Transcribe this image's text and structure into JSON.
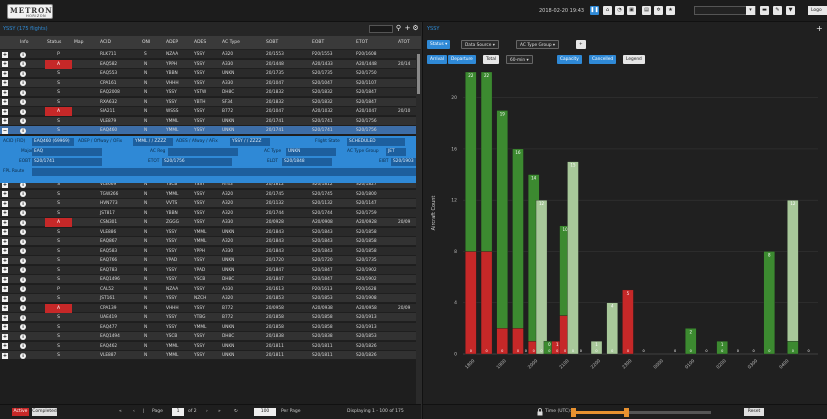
{
  "app": {
    "logo_main": "METRON",
    "logo_sub": "HORIZON",
    "clock": "2018-02-20 19:43"
  },
  "topbar": {
    "search_value": "",
    "logout_label": "Logo"
  },
  "left_panel": {
    "title": "YSSY (175 flights)",
    "columns": [
      "Info",
      "Status",
      "Map",
      "ACID",
      "ONI",
      "ADEP",
      "ADES",
      "AC Type",
      "SOBT",
      "EOBT",
      "ETOT",
      "ATOT"
    ],
    "rows": [
      {
        "status": "P",
        "red": false,
        "acid": "RLK711",
        "oni": "S",
        "adep": "NZAA",
        "ades": "YSSY",
        "actype": "A320",
        "sobt": "20/1553",
        "eobt": "P20/1553",
        "etot": "P20/1608",
        "atot": ""
      },
      {
        "status": "A",
        "red": true,
        "acid": "EAQ582",
        "oni": "N",
        "adep": "YPPH",
        "ades": "YSSY",
        "actype": "A330",
        "sobt": "20/1448",
        "eobt": "A20/1433",
        "etot": "A20/1448",
        "atot": "20/14"
      },
      {
        "status": "S",
        "red": false,
        "acid": "EAQ553",
        "oni": "N",
        "adep": "YBBN",
        "ades": "YSSY",
        "actype": "UNKN",
        "sobt": "20/1735",
        "eobt": "S20/1735",
        "etot": "S20/1750",
        "atot": ""
      },
      {
        "status": "S",
        "red": false,
        "acid": "CPA161",
        "oni": "N",
        "adep": "VHHH",
        "ades": "YSSY",
        "actype": "A330",
        "sobt": "20/1047",
        "eobt": "S20/1047",
        "etot": "S20/1107",
        "atot": ""
      },
      {
        "status": "S",
        "red": false,
        "acid": "EAQ2008",
        "oni": "N",
        "adep": "YSSY",
        "ades": "YSTW",
        "actype": "DH8C",
        "sobt": "20/1832",
        "eobt": "S20/1832",
        "etot": "S20/1847",
        "atot": ""
      },
      {
        "status": "S",
        "red": false,
        "acid": "RXA632",
        "oni": "N",
        "adep": "YSSY",
        "ades": "YBTH",
        "actype": "SF34",
        "sobt": "20/1832",
        "eobt": "S20/1832",
        "etot": "S20/1847",
        "atot": ""
      },
      {
        "status": "A",
        "red": true,
        "acid": "SIA211",
        "oni": "N",
        "adep": "WSSS",
        "ades": "YSSY",
        "actype": "B772",
        "sobt": "20/1047",
        "eobt": "A20/1032",
        "etot": "A20/1047",
        "atot": "20/10"
      },
      {
        "status": "S",
        "red": false,
        "acid": "VLE879",
        "oni": "N",
        "adep": "YMML",
        "ades": "YSSY",
        "actype": "UNKN",
        "sobt": "20/1741",
        "eobt": "S20/1741",
        "etot": "S20/1756",
        "atot": ""
      },
      {
        "status": "S",
        "red": false,
        "acid": "EAQ460",
        "oni": "N",
        "adep": "YMML",
        "ades": "YSSY",
        "actype": "UNKN",
        "sobt": "20/1741",
        "eobt": "S20/1741",
        "etot": "S20/1756",
        "atot": ""
      },
      {
        "status": "S",
        "red": false,
        "acid": "VLE669",
        "oni": "N",
        "adep": "YSCB",
        "ades": "YSSY",
        "actype": "AT43",
        "sobt": "20/1812",
        "eobt": "S20/1812",
        "etot": "S20/1827",
        "atot": ""
      },
      {
        "status": "S",
        "red": false,
        "acid": "TGW266",
        "oni": "N",
        "adep": "YMML",
        "ades": "YSSY",
        "actype": "A320",
        "sobt": "20/1745",
        "eobt": "S20/1745",
        "etot": "S20/1800",
        "atot": ""
      },
      {
        "status": "S",
        "red": false,
        "acid": "HVN773",
        "oni": "N",
        "adep": "VVTS",
        "ades": "YSSY",
        "actype": "A320",
        "sobt": "20/1132",
        "eobt": "S20/1132",
        "etot": "S20/1147",
        "atot": ""
      },
      {
        "status": "S",
        "red": false,
        "acid": "JST817",
        "oni": "N",
        "adep": "YBBN",
        "ades": "YSSY",
        "actype": "A320",
        "sobt": "20/1744",
        "eobt": "S20/1744",
        "etot": "S20/1759",
        "atot": ""
      },
      {
        "status": "A",
        "red": true,
        "acid": "CSN301",
        "oni": "N",
        "adep": "ZGGG",
        "ades": "YSSY",
        "actype": "A330",
        "sobt": "20/0928",
        "eobt": "A20/0908",
        "etot": "A20/0928",
        "atot": "20/09"
      },
      {
        "status": "S",
        "red": false,
        "acid": "VLE886",
        "oni": "N",
        "adep": "YSSY",
        "ades": "YMML",
        "actype": "UNKN",
        "sobt": "20/1843",
        "eobt": "S20/1843",
        "etot": "S20/1858",
        "atot": ""
      },
      {
        "status": "S",
        "red": false,
        "acid": "EAQ867",
        "oni": "N",
        "adep": "YSSY",
        "ades": "YMML",
        "actype": "A320",
        "sobt": "20/1843",
        "eobt": "S20/1843",
        "etot": "S20/1858",
        "atot": ""
      },
      {
        "status": "S",
        "red": false,
        "acid": "EAQ583",
        "oni": "N",
        "adep": "YSSY",
        "ades": "YPPH",
        "actype": "A330",
        "sobt": "20/1843",
        "eobt": "S20/1843",
        "etot": "S20/1858",
        "atot": ""
      },
      {
        "status": "S",
        "red": false,
        "acid": "EAQ766",
        "oni": "N",
        "adep": "YPAD",
        "ades": "YSSY",
        "actype": "UNKN",
        "sobt": "20/1720",
        "eobt": "S20/1720",
        "etot": "S20/1735",
        "atot": ""
      },
      {
        "status": "S",
        "red": false,
        "acid": "EAQ783",
        "oni": "N",
        "adep": "YSSY",
        "ades": "YPAD",
        "actype": "UNKN",
        "sobt": "20/1847",
        "eobt": "S20/1847",
        "etot": "S20/1902",
        "atot": ""
      },
      {
        "status": "S",
        "red": false,
        "acid": "EAQ1496",
        "oni": "N",
        "adep": "YSSY",
        "ades": "YSCB",
        "actype": "DH8C",
        "sobt": "20/1847",
        "eobt": "S20/1847",
        "etot": "S20/1902",
        "atot": ""
      },
      {
        "status": "P",
        "red": false,
        "acid": "CAL52",
        "oni": "N",
        "adep": "NZAA",
        "ades": "YSSY",
        "actype": "A330",
        "sobt": "20/1613",
        "eobt": "P20/1613",
        "etot": "P20/1628",
        "atot": ""
      },
      {
        "status": "S",
        "red": false,
        "acid": "JST161",
        "oni": "N",
        "adep": "YSSY",
        "ades": "NZCH",
        "actype": "A320",
        "sobt": "20/1853",
        "eobt": "S20/1853",
        "etot": "S20/1908",
        "atot": ""
      },
      {
        "status": "A",
        "red": true,
        "acid": "CPA139",
        "oni": "N",
        "adep": "VHHH",
        "ades": "YSSY",
        "actype": "B772",
        "sobt": "20/0958",
        "eobt": "A20/0938",
        "etot": "A20/0958",
        "atot": "20/09"
      },
      {
        "status": "S",
        "red": false,
        "acid": "UAE419",
        "oni": "N",
        "adep": "YSSY",
        "ades": "YTBG",
        "actype": "B772",
        "sobt": "20/1858",
        "eobt": "S20/1858",
        "etot": "S20/1913",
        "atot": ""
      },
      {
        "status": "S",
        "red": false,
        "acid": "EAQ477",
        "oni": "N",
        "adep": "YSSY",
        "ades": "YMML",
        "actype": "UNKN",
        "sobt": "20/1858",
        "eobt": "S20/1858",
        "etot": "S20/1913",
        "atot": ""
      },
      {
        "status": "S",
        "red": false,
        "acid": "EAQ1494",
        "oni": "N",
        "adep": "YSCB",
        "ades": "YSSY",
        "actype": "DH8C",
        "sobt": "20/1838",
        "eobt": "S20/1838",
        "etot": "S20/1853",
        "atot": ""
      },
      {
        "status": "S",
        "red": false,
        "acid": "EAQ462",
        "oni": "N",
        "adep": "YMML",
        "ades": "YSSY",
        "actype": "UNKN",
        "sobt": "20/1811",
        "eobt": "S20/1811",
        "etot": "S20/1826",
        "atot": ""
      },
      {
        "status": "S",
        "red": false,
        "acid": "VLE887",
        "oni": "N",
        "adep": "YMML",
        "ades": "YSSY",
        "actype": "UNKN",
        "sobt": "20/1811",
        "eobt": "S20/1811",
        "etot": "S20/1826",
        "atot": ""
      }
    ],
    "detail": {
      "acid_label": "ACID (FID)",
      "acid_value": "EAQ460 (69969)",
      "adep_label": "ADEP / Offway / OFix",
      "adep_value": "YMML / / ZZZZ",
      "ades_label": "ADES / Afway / AFix",
      "ades_value": "YSSY / / ZZZZ",
      "flight_state_label": "Flight State",
      "flight_state_value": "SCHEDULED",
      "major_label": "Major",
      "major_value": "EAQ",
      "acreg_label": "AC Reg",
      "acreg_value": "",
      "actype_label": "AC Type",
      "actype_value": "UNKN",
      "actypegroup_label": "AC Type Group",
      "actypegroup_value": "JET",
      "eobt_label": "EOBT",
      "eobt_value": "S20/1741",
      "etot_label": "ETOT",
      "etot_value": "S20/1756",
      "eldt_label": "ELDT",
      "eldt_value": "S20/1848",
      "eibt_label": "EIBT",
      "eibt_value": "S20/1903",
      "fpl_label": "FPL Route",
      "fpl_value": ""
    }
  },
  "pager": {
    "active_label": "Active",
    "completed_label": "Completed",
    "page_label": "Page",
    "page_value": "1",
    "of_label": "of 2",
    "page_size": "100",
    "per_page_label": "Per Page",
    "displaying": "Displaying 1 - 100 of 175"
  },
  "right_panel": {
    "title": "YSSY",
    "filters": {
      "status": "Status",
      "data_source": "Data Source",
      "ac_type_group": "AC Type Group"
    },
    "toggles": {
      "arrival": "Arrival",
      "departure": "Departure",
      "total": "Total",
      "interval": "60-min",
      "capacity": "Capacity",
      "cancelled": "Cancelled",
      "legend": "Legend"
    },
    "time_label": "Time (UTC):",
    "reset_label": "Reset"
  },
  "colors": {
    "accent": "#2f89d6",
    "red": "#c62828",
    "green_dark": "#3c8a30",
    "green_light": "#a8c89a",
    "bg": "#202020"
  },
  "chart_data": {
    "type": "bar",
    "stacked": true,
    "ylabel": "Aircraft Count",
    "ylim": [
      0,
      22
    ],
    "yticks": [
      0,
      4,
      8,
      12,
      16,
      20
    ],
    "xticks": [
      "1800",
      "1900",
      "2000",
      "2100",
      "2200",
      "2300",
      "0000",
      "0100",
      "0200",
      "0300",
      "0400"
    ],
    "bars": [
      {
        "x": 0.5,
        "red": 8,
        "dark": 14,
        "light": 0,
        "total_label": "22"
      },
      {
        "x": 1.5,
        "red": 8,
        "dark": 14,
        "light": 0,
        "total_label": "22"
      },
      {
        "x": 2.5,
        "red": 2,
        "dark": 17,
        "light": 0,
        "total_label": "19"
      },
      {
        "x": 3.5,
        "red": 2,
        "dark": 14,
        "light": 0,
        "total_label": "16"
      },
      {
        "x": 4.0,
        "red": 0,
        "dark": 0,
        "light": 0,
        "total_label": "0"
      },
      {
        "x": 4.5,
        "red": 1,
        "dark": 13,
        "light": 0,
        "total_label": "14"
      },
      {
        "x": 5.0,
        "red": 0,
        "dark": 0,
        "light": 12,
        "total_label": "12"
      },
      {
        "x": 5.5,
        "red": 0,
        "dark": 1,
        "light": 0,
        "total_label": "0"
      },
      {
        "x": 6.0,
        "red": 1,
        "dark": 0,
        "light": 0,
        "total_label": "1"
      },
      {
        "x": 6.5,
        "red": 3,
        "dark": 7,
        "light": 0,
        "total_label": "10"
      },
      {
        "x": 7.0,
        "red": 0,
        "dark": 0,
        "light": 15,
        "total_label": "15"
      },
      {
        "x": 7.5,
        "red": 0,
        "dark": 0,
        "light": 0,
        "total_label": "0"
      },
      {
        "x": 8.5,
        "red": 0,
        "dark": 0,
        "light": 1,
        "total_label": "1"
      },
      {
        "x": 9.5,
        "red": 0,
        "dark": 0,
        "light": 4,
        "total_label": "4"
      },
      {
        "x": 10.5,
        "red": 5,
        "dark": 0,
        "light": 0,
        "total_label": "5"
      },
      {
        "x": 11.5,
        "red": 0,
        "dark": 0,
        "light": 0,
        "total_label": "0"
      },
      {
        "x": 13.5,
        "red": 0,
        "dark": 0,
        "light": 0,
        "total_label": "0"
      },
      {
        "x": 14.5,
        "red": 0,
        "dark": 2,
        "light": 0,
        "total_label": "2"
      },
      {
        "x": 15.5,
        "red": 0,
        "dark": 0,
        "light": 0,
        "total_label": "0"
      },
      {
        "x": 16.5,
        "red": 0,
        "dark": 1,
        "light": 0,
        "total_label": "1"
      },
      {
        "x": 17.5,
        "red": 0,
        "dark": 0,
        "light": 0,
        "total_label": "0"
      },
      {
        "x": 18.5,
        "red": 0,
        "dark": 0,
        "light": 0,
        "total_label": "0"
      },
      {
        "x": 19.5,
        "red": 0,
        "dark": 8,
        "light": 0,
        "total_label": "8"
      },
      {
        "x": 21.0,
        "red": 0,
        "dark": 1,
        "light": 11,
        "total_label": "12"
      },
      {
        "x": 22.0,
        "red": 0,
        "dark": 0,
        "light": 0,
        "total_label": "0"
      }
    ]
  }
}
